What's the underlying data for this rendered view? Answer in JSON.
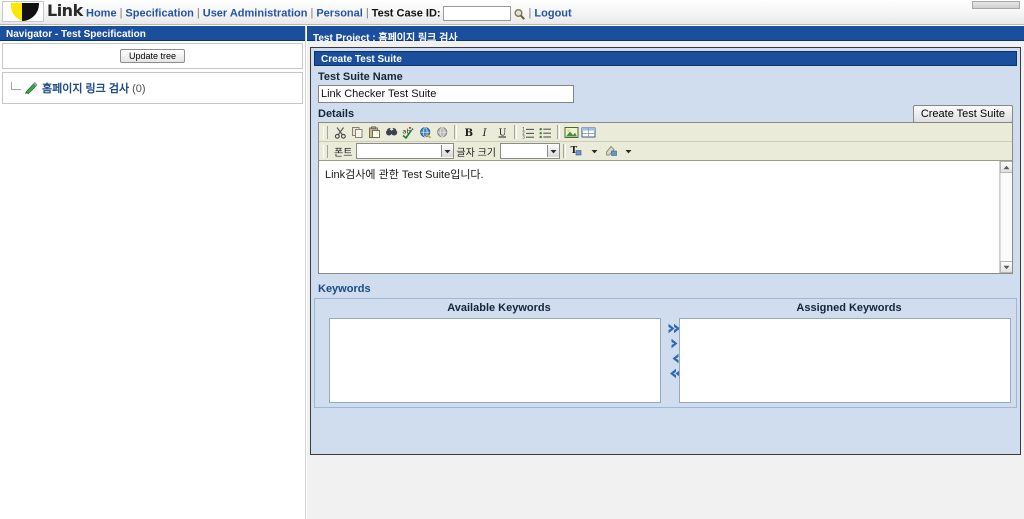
{
  "topbar": {
    "brand": "Link",
    "logo_icon": "pacman-logo",
    "nav": [
      {
        "label": "Home",
        "name": "nav-home"
      },
      {
        "label": "Specification",
        "name": "nav-specification"
      },
      {
        "label": "User Administration",
        "name": "nav-user-administration"
      },
      {
        "label": "Personal",
        "name": "nav-personal"
      }
    ],
    "separator": "|",
    "testcase_label": "Test Case ID:",
    "testcase_value": "",
    "testcase_placeholder": "",
    "search_icon": "search-icon",
    "logout": "Logout"
  },
  "navigator": {
    "title": "Navigator - Test Specification",
    "update_tree_label": "Update tree",
    "tree": {
      "icon": "pencil-icon",
      "label": "홈페이지 링크 검사",
      "count": "(0)"
    }
  },
  "main": {
    "project_title": "Test Project : 홈페이지 링크 검사",
    "section_title": "Create Test Suite",
    "test_suite_name_label": "Test Suite Name",
    "test_suite_name_value": "Link Checker Test Suite",
    "create_button": "Create Test Suite",
    "details_label": "Details",
    "editor": {
      "toolbar_row1": [
        {
          "name": "cut-icon",
          "title": "Cut"
        },
        {
          "name": "copy-icon",
          "title": "Copy"
        },
        {
          "name": "paste-icon",
          "title": "Paste"
        },
        {
          "name": "find-icon",
          "title": "Find"
        },
        {
          "name": "spellcheck-icon",
          "title": "Spell Check"
        },
        {
          "name": "insert-link-icon",
          "title": "Insert Link"
        },
        {
          "name": "remove-link-icon",
          "title": "Remove Link"
        },
        {
          "name": "bold-icon",
          "title": "Bold"
        },
        {
          "name": "italic-icon",
          "title": "Italic"
        },
        {
          "name": "underline-icon",
          "title": "Underline"
        },
        {
          "name": "ordered-list-icon",
          "title": "Numbered List"
        },
        {
          "name": "bullet-list-icon",
          "title": "Bulleted List"
        },
        {
          "name": "insert-image-icon",
          "title": "Insert Image"
        },
        {
          "name": "insert-table-icon",
          "title": "Insert Table"
        }
      ],
      "font_label": "폰트",
      "font_value": "",
      "size_label": "글자 크기",
      "size_value": "",
      "text_color_icon": "text-color-icon",
      "highlight_color_icon": "highlight-color-icon",
      "body_text": "Link검사에 관한 Test Suite입니다."
    },
    "keywords": {
      "section_label": "Keywords",
      "available_label": "Available Keywords",
      "assigned_label": "Assigned Keywords",
      "available_items": [],
      "assigned_items": [],
      "buttons": [
        {
          "name": "assign-all-button",
          "icon": "double-right-arrow-icon"
        },
        {
          "name": "assign-button",
          "icon": "single-right-arrow-icon"
        },
        {
          "name": "unassign-button",
          "icon": "single-left-arrow-icon"
        },
        {
          "name": "unassign-all-button",
          "icon": "double-left-arrow-icon"
        }
      ]
    }
  },
  "colors": {
    "header_blue": "#194f9c",
    "panel_blue": "#cfddef",
    "link_blue": "#2255aa",
    "toolbar_beige": "#ebebda",
    "arrow_blue": "#2f68b5"
  }
}
